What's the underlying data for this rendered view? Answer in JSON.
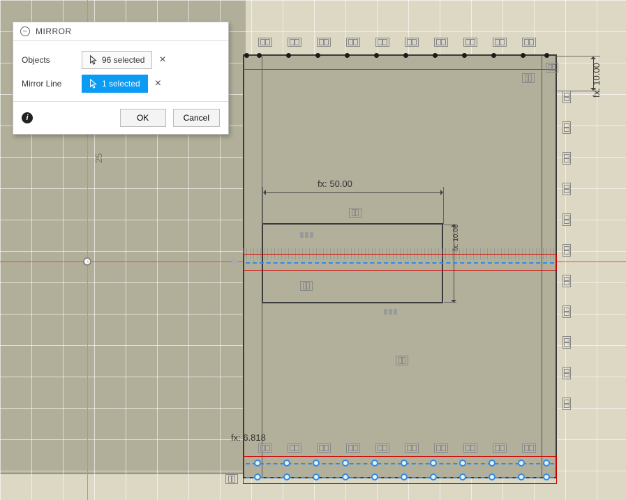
{
  "dialog": {
    "title": "MIRROR",
    "rows": {
      "objects": {
        "label": "Objects",
        "chip": "96 selected"
      },
      "mirror_line": {
        "label": "Mirror Line",
        "chip": "1 selected"
      }
    },
    "ok": "OK",
    "cancel": "Cancel"
  },
  "dimensions": {
    "dim_50": "fx: 50.00",
    "dim_10": "fx: 10.00",
    "dim_side": "fx: 10.00",
    "dim_6_818": "fx: 6.818",
    "origin_dia": "25"
  },
  "colors": {
    "accent": "#0a9cf5",
    "select": "#2e8be6",
    "error_box": "#d10000"
  }
}
